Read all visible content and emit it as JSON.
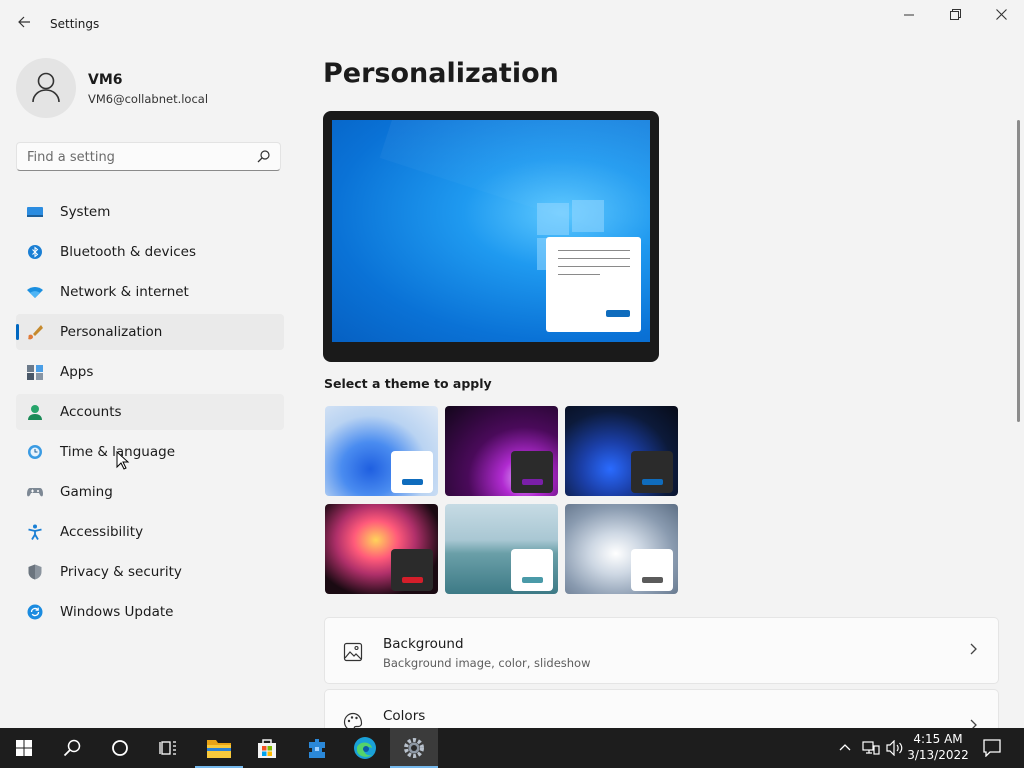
{
  "window": {
    "title": "Settings",
    "back_icon": "back-arrow-icon"
  },
  "profile": {
    "name": "VM6",
    "email": "VM6@collabnet.local"
  },
  "search": {
    "placeholder": "Find a setting"
  },
  "nav": {
    "items": [
      {
        "label": "System",
        "icon": "system-icon"
      },
      {
        "label": "Bluetooth & devices",
        "icon": "bluetooth-icon"
      },
      {
        "label": "Network & internet",
        "icon": "wifi-icon"
      },
      {
        "label": "Personalization",
        "icon": "brush-icon",
        "selected": true
      },
      {
        "label": "Apps",
        "icon": "apps-icon"
      },
      {
        "label": "Accounts",
        "icon": "accounts-icon",
        "hovered": true
      },
      {
        "label": "Time & language",
        "icon": "time-language-icon"
      },
      {
        "label": "Gaming",
        "icon": "gamepad-icon"
      },
      {
        "label": "Accessibility",
        "icon": "accessibility-icon"
      },
      {
        "label": "Privacy & security",
        "icon": "shield-icon"
      },
      {
        "label": "Windows Update",
        "icon": "update-icon"
      }
    ]
  },
  "main": {
    "title": "Personalization",
    "theme_section_label": "Select a theme to apply",
    "themes": [
      {
        "name": "light-bloom"
      },
      {
        "name": "glow"
      },
      {
        "name": "dark-bloom"
      },
      {
        "name": "captured-motion"
      },
      {
        "name": "sunrise"
      },
      {
        "name": "flow"
      }
    ],
    "cards": [
      {
        "title": "Background",
        "subtitle": "Background image, color, slideshow",
        "icon": "image-icon"
      },
      {
        "title": "Colors",
        "subtitle": "",
        "icon": "palette-icon"
      }
    ]
  },
  "taskbar": {
    "clock": {
      "time": "4:15 AM",
      "date": "3/13/2022"
    }
  },
  "colors": {
    "accent": "#0067c0",
    "taskbar": "#1d1d1d",
    "background": "#f3f3f3"
  }
}
